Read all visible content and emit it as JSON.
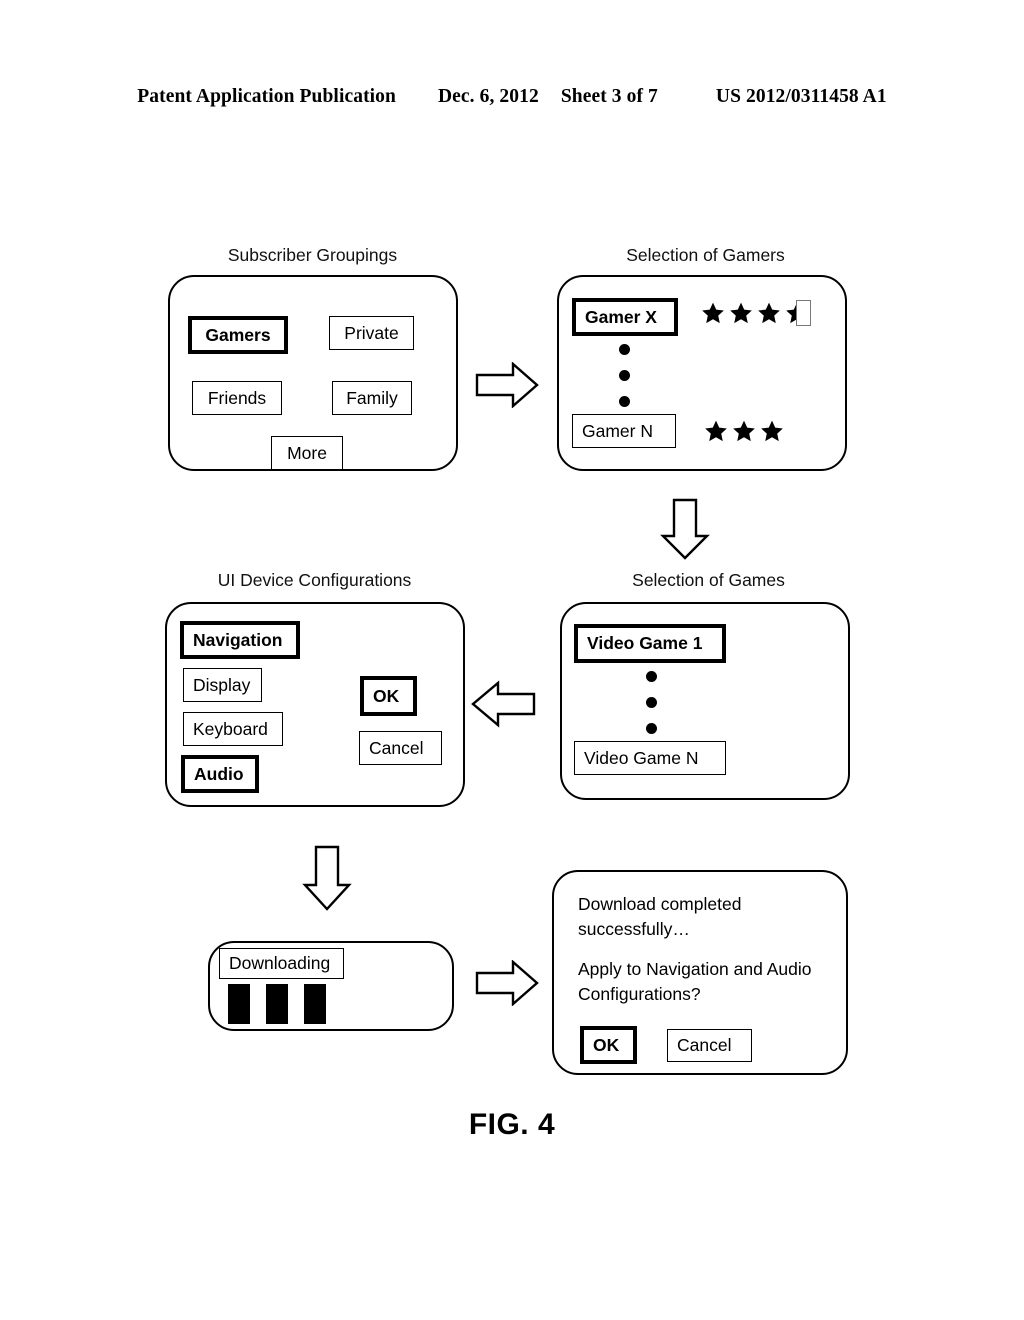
{
  "header": {
    "publication": "Patent Application Publication",
    "date": "Dec. 6, 2012",
    "sheet": "Sheet 3 of 7",
    "patent_number": "US 2012/0311458 A1"
  },
  "figure": {
    "label": "FIG. 4"
  },
  "panels": {
    "subscriber_groupings": {
      "caption": "Subscriber Groupings",
      "options": [
        {
          "label": "Gamers",
          "selected": true
        },
        {
          "label": "Private",
          "selected": false
        },
        {
          "label": "Friends",
          "selected": false
        },
        {
          "label": "Family",
          "selected": false
        },
        {
          "label": "More",
          "selected": false
        }
      ]
    },
    "selection_of_gamers": {
      "caption": "Selection of Gamers",
      "rows": [
        {
          "label": "Gamer X",
          "selected": true,
          "rating": 3.5,
          "max_rating": 4
        },
        {
          "label": "Gamer N",
          "selected": false,
          "rating": 3,
          "max_rating": 3
        }
      ],
      "ellipsis_dots": 3
    },
    "ui_device_configurations": {
      "caption": "UI Device Configurations",
      "options": [
        {
          "label": "Navigation",
          "selected": true
        },
        {
          "label": "Display",
          "selected": false
        },
        {
          "label": "Keyboard",
          "selected": false
        },
        {
          "label": "Audio",
          "selected": true
        }
      ],
      "buttons": [
        {
          "label": "OK",
          "selected": true
        },
        {
          "label": "Cancel",
          "selected": false
        }
      ]
    },
    "selection_of_games": {
      "caption": "Selection of Games",
      "rows": [
        {
          "label": "Video Game 1",
          "selected": true
        },
        {
          "label": "Video Game N",
          "selected": false
        }
      ],
      "ellipsis_dots": 3
    },
    "downloading": {
      "status_label": "Downloading",
      "progress_blocks": 3
    },
    "download_complete": {
      "message_line1": "Download completed\nsuccessfully…",
      "message_line2": "Apply to Navigation and Audio\nConfigurations?",
      "buttons": [
        {
          "label": "OK",
          "selected": true
        },
        {
          "label": "Cancel",
          "selected": false
        }
      ]
    }
  },
  "arrows": [
    {
      "name": "groupings-to-gamers",
      "direction": "right"
    },
    {
      "name": "gamers-to-games",
      "direction": "down"
    },
    {
      "name": "games-to-configurations",
      "direction": "left"
    },
    {
      "name": "configurations-to-downloading",
      "direction": "down"
    },
    {
      "name": "downloading-to-complete",
      "direction": "right"
    }
  ],
  "colors": {
    "ink": "#000000",
    "paper": "#ffffff",
    "half_star_outline": "#777777"
  }
}
